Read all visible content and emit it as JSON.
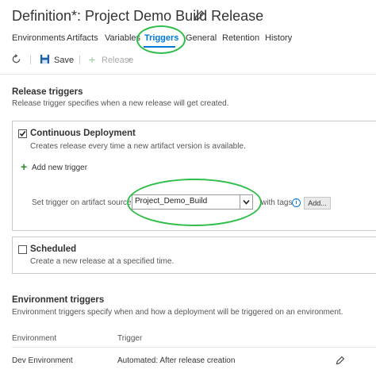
{
  "title": "Definition*: Project Demo Build Release",
  "tabs": [
    {
      "label": "Environments"
    },
    {
      "label": "Artifacts"
    },
    {
      "label": "Variables"
    },
    {
      "label": "Triggers"
    },
    {
      "label": "General"
    },
    {
      "label": "Retention"
    },
    {
      "label": "History"
    }
  ],
  "toolbar": {
    "save_label": "Save",
    "release_label": "Release"
  },
  "release_triggers": {
    "heading": "Release triggers",
    "description": "Release trigger specifies when a new release will get created.",
    "continuous": {
      "label": "Continuous Deployment",
      "checked": true,
      "description": "Creates release every time a new artifact version is available.",
      "add_trigger_label": "Add new trigger",
      "source_label": "Set trigger on artifact source",
      "source_value": "Project_Demo_Build",
      "with_tags_label": "with tags",
      "add_button": "Add..."
    },
    "scheduled": {
      "label": "Scheduled",
      "checked": false,
      "description": "Create a new release at a specified time."
    }
  },
  "environment_triggers": {
    "heading": "Environment triggers",
    "description": "Environment triggers specify when and how a deployment will be triggered on an environment.",
    "columns": [
      "Environment",
      "Trigger"
    ],
    "rows": [
      {
        "environment": "Dev Environment",
        "trigger": "Automated: After release creation"
      }
    ]
  },
  "colors": {
    "accent": "#0078d7",
    "highlight": "#2dbd48",
    "add_green": "#2a8f2a"
  }
}
